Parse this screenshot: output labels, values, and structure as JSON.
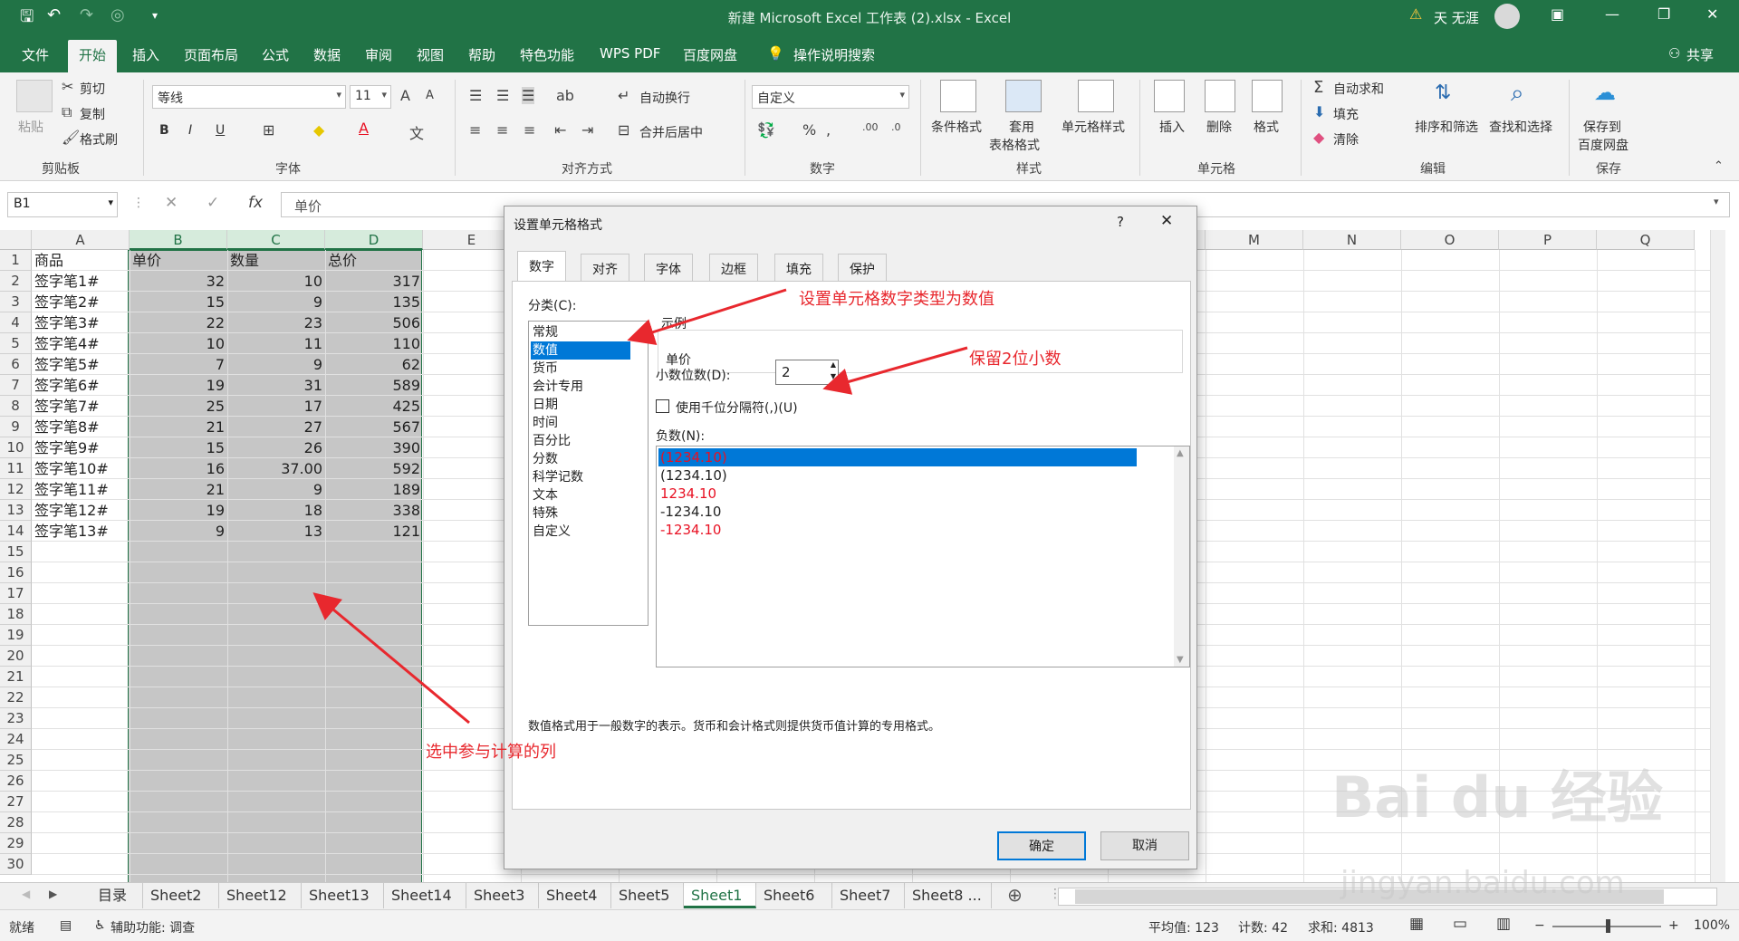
{
  "window": {
    "title": "新建 Microsoft Excel 工作表 (2).xlsx  -  Excel",
    "user": "天 无涯"
  },
  "ribbon_tabs": [
    "文件",
    "开始",
    "插入",
    "页面布局",
    "公式",
    "数据",
    "审阅",
    "视图",
    "帮助",
    "特色功能",
    "WPS PDF",
    "百度网盘"
  ],
  "tellme": "操作说明搜索",
  "share": "共享",
  "clipboard": {
    "paste": "粘贴",
    "cut": "剪切",
    "copy": "复制",
    "painter": "格式刷",
    "group": "剪贴板"
  },
  "font": {
    "name": "等线",
    "size": "11",
    "group": "字体",
    "bold": "B",
    "italic": "I",
    "underline": "U"
  },
  "alignment": {
    "wrap": "自动换行",
    "merge": "合并后居中",
    "group": "对齐方式"
  },
  "number": {
    "format": "自定义",
    "group": "数字"
  },
  "styles": {
    "cond": "条件格式",
    "table1": "套用",
    "table2": "表格格式",
    "cell": "单元格样式",
    "group": "样式"
  },
  "cells": {
    "insert": "插入",
    "delete": "删除",
    "format": "格式",
    "group": "单元格"
  },
  "editing": {
    "autosum": "自动求和",
    "fill": "填充",
    "clear": "清除",
    "sort": "排序和筛选",
    "find": "查找和选择",
    "group": "编辑"
  },
  "save": {
    "l1": "保存到",
    "l2": "百度网盘",
    "group": "保存"
  },
  "namebox": "B1",
  "formula": "单价",
  "columns": [
    "A",
    "B",
    "C",
    "D",
    "E",
    "",
    "",
    "",
    "",
    "",
    "",
    "",
    "M",
    "N",
    "O",
    "P",
    "Q"
  ],
  "headers": [
    "商品",
    "单价",
    "数量",
    "总价"
  ],
  "rows": [
    [
      "签字笔1#",
      "32",
      "10",
      "317"
    ],
    [
      "签字笔2#",
      "15",
      "9",
      "135"
    ],
    [
      "签字笔3#",
      "22",
      "23",
      "506"
    ],
    [
      "签字笔4#",
      "10",
      "11",
      "110"
    ],
    [
      "签字笔5#",
      "7",
      "9",
      "62"
    ],
    [
      "签字笔6#",
      "19",
      "31",
      "589"
    ],
    [
      "签字笔7#",
      "25",
      "17",
      "425"
    ],
    [
      "签字笔8#",
      "21",
      "27",
      "567"
    ],
    [
      "签字笔9#",
      "15",
      "26",
      "390"
    ],
    [
      "签字笔10#",
      "16",
      "37.00",
      "592"
    ],
    [
      "签字笔11#",
      "21",
      "9",
      "189"
    ],
    [
      "签字笔12#",
      "19",
      "18",
      "338"
    ],
    [
      "签字笔13#",
      "9",
      "13",
      "121"
    ]
  ],
  "row_numbers": [
    "1",
    "2",
    "3",
    "4",
    "5",
    "6",
    "7",
    "8",
    "9",
    "10",
    "11",
    "12",
    "13",
    "14",
    "15",
    "16",
    "17",
    "18",
    "19",
    "20",
    "21",
    "22",
    "23",
    "24",
    "25",
    "26",
    "27",
    "28",
    "29",
    "30"
  ],
  "sheets": [
    "目录",
    "Sheet2",
    "Sheet12",
    "Sheet13",
    "Sheet14",
    "Sheet3",
    "Sheet4",
    "Sheet5",
    "Sheet1",
    "Sheet6",
    "Sheet7",
    "Sheet8 ..."
  ],
  "active_sheet": "Sheet1",
  "status": {
    "mode": "就绪",
    "accessibility": "辅助功能: 调查",
    "average": "平均值: 123",
    "count": "计数: 42",
    "sum": "求和: 4813",
    "zoom": "100%"
  },
  "dialog": {
    "title": "设置单元格格式",
    "help": "?",
    "close": "✕",
    "tabs": [
      "数字",
      "对齐",
      "字体",
      "边框",
      "填充",
      "保护"
    ],
    "category_label": "分类(C):",
    "categories": [
      "常规",
      "数值",
      "货币",
      "会计专用",
      "日期",
      "时间",
      "百分比",
      "分数",
      "科学记数",
      "文本",
      "特殊",
      "自定义"
    ],
    "selected_category": "数值",
    "sample_label": "示例",
    "sample_value": "单价",
    "decimals_label": "小数位数(D):",
    "decimals_value": "2",
    "thousands_label": "使用千位分隔符(,)(U)",
    "negative_label": "负数(N):",
    "negatives": [
      "(1234.10)",
      "(1234.10)",
      "1234.10",
      "-1234.10",
      "-1234.10"
    ],
    "description": "数值格式用于一般数字的表示。货币和会计格式则提供货币值计算的专用格式。",
    "ok": "确定",
    "cancel": "取消"
  },
  "annotations": {
    "a1": "设置单元格数字类型为数值",
    "a2": "保留2位小数",
    "a3": "选中参与计算的列"
  },
  "watermark": {
    "main": "Bai du 经验",
    "url": "jingyan.baidu.com"
  },
  "colors": {
    "excel_green": "#217346",
    "selection_blue": "#0078d7",
    "annotation_red": "#e8282e",
    "negative_red": "#e81123"
  }
}
